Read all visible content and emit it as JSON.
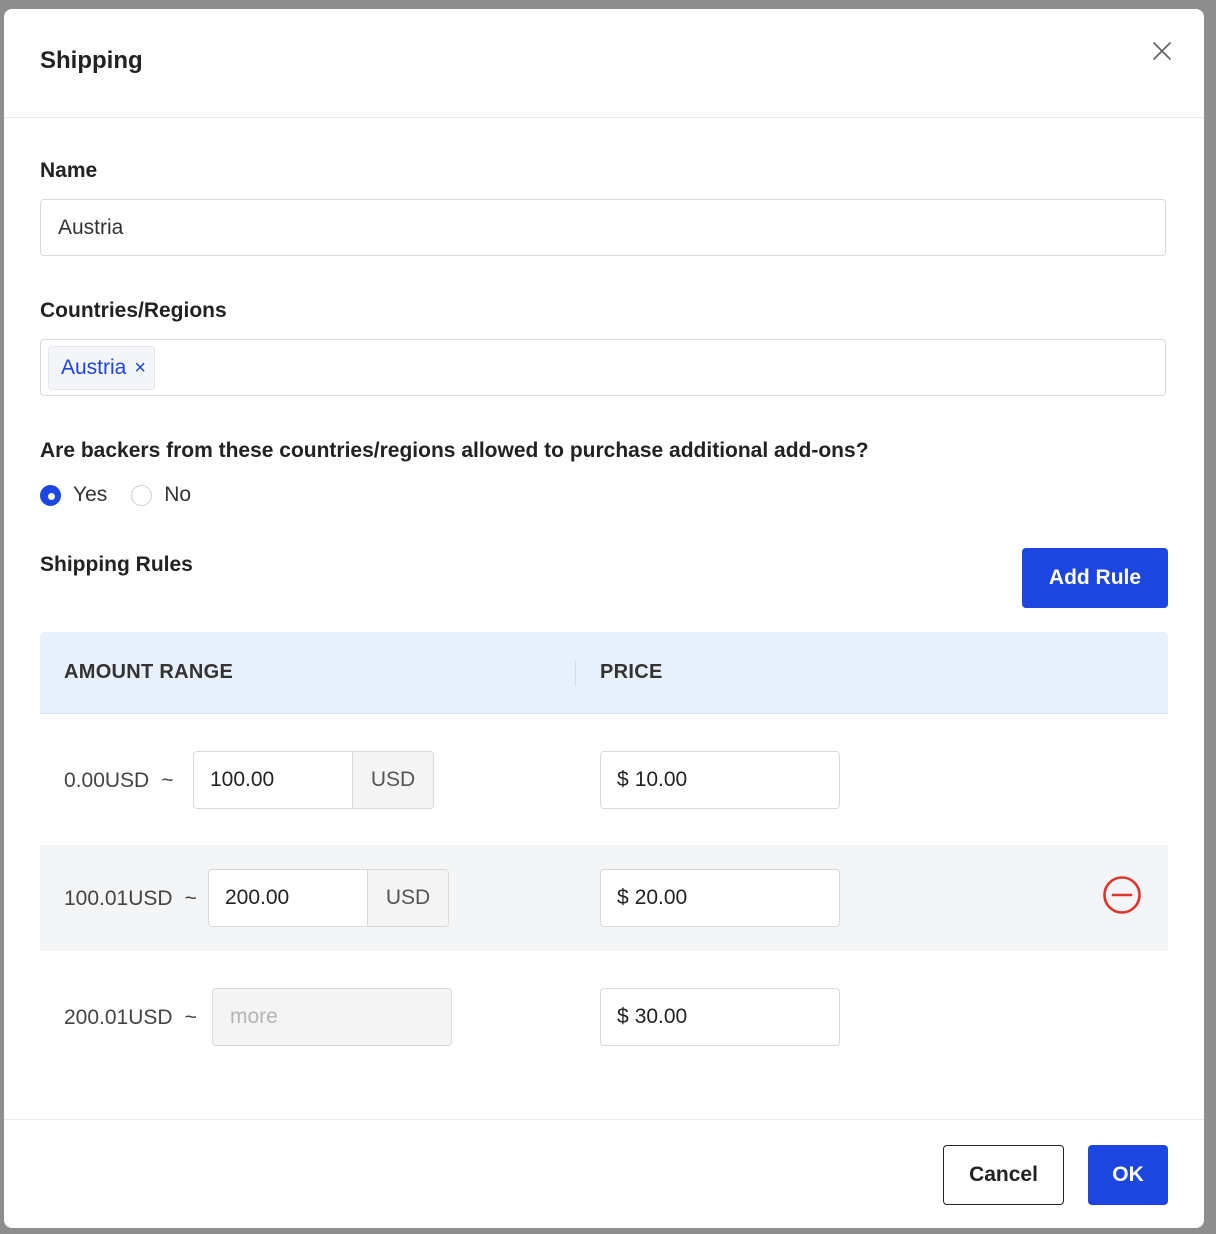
{
  "dialog": {
    "title": "Shipping"
  },
  "name_field": {
    "label": "Name",
    "value": "Austria"
  },
  "regions_field": {
    "label": "Countries/Regions",
    "tags": [
      {
        "label": "Austria"
      }
    ]
  },
  "addons_question": {
    "label": "Are backers from these countries/regions allowed to purchase additional add-ons?",
    "options": [
      {
        "label": "Yes",
        "checked": true
      },
      {
        "label": "No",
        "checked": false
      }
    ]
  },
  "shipping_rules": {
    "label": "Shipping Rules",
    "add_button": "Add Rule",
    "columns": {
      "amount_range": "AMOUNT RANGE",
      "price": "PRICE"
    },
    "rows": [
      {
        "start": "0.00USD",
        "separator": "~",
        "end_value": "100.00",
        "end_unit": "USD",
        "currency_symbol": "$",
        "price": "10.00"
      },
      {
        "start": "100.01USD",
        "separator": "~",
        "end_value": "200.00",
        "end_unit": "USD",
        "currency_symbol": "$",
        "price": "20.00"
      },
      {
        "start": "200.01USD",
        "separator": "~",
        "end_placeholder": "more",
        "currency_symbol": "$",
        "price": "30.00"
      }
    ]
  },
  "footer": {
    "cancel": "Cancel",
    "ok": "OK"
  },
  "colors": {
    "primary": "#1d46e0",
    "danger": "#e0332a",
    "table_header_bg": "#e8f0fc"
  }
}
